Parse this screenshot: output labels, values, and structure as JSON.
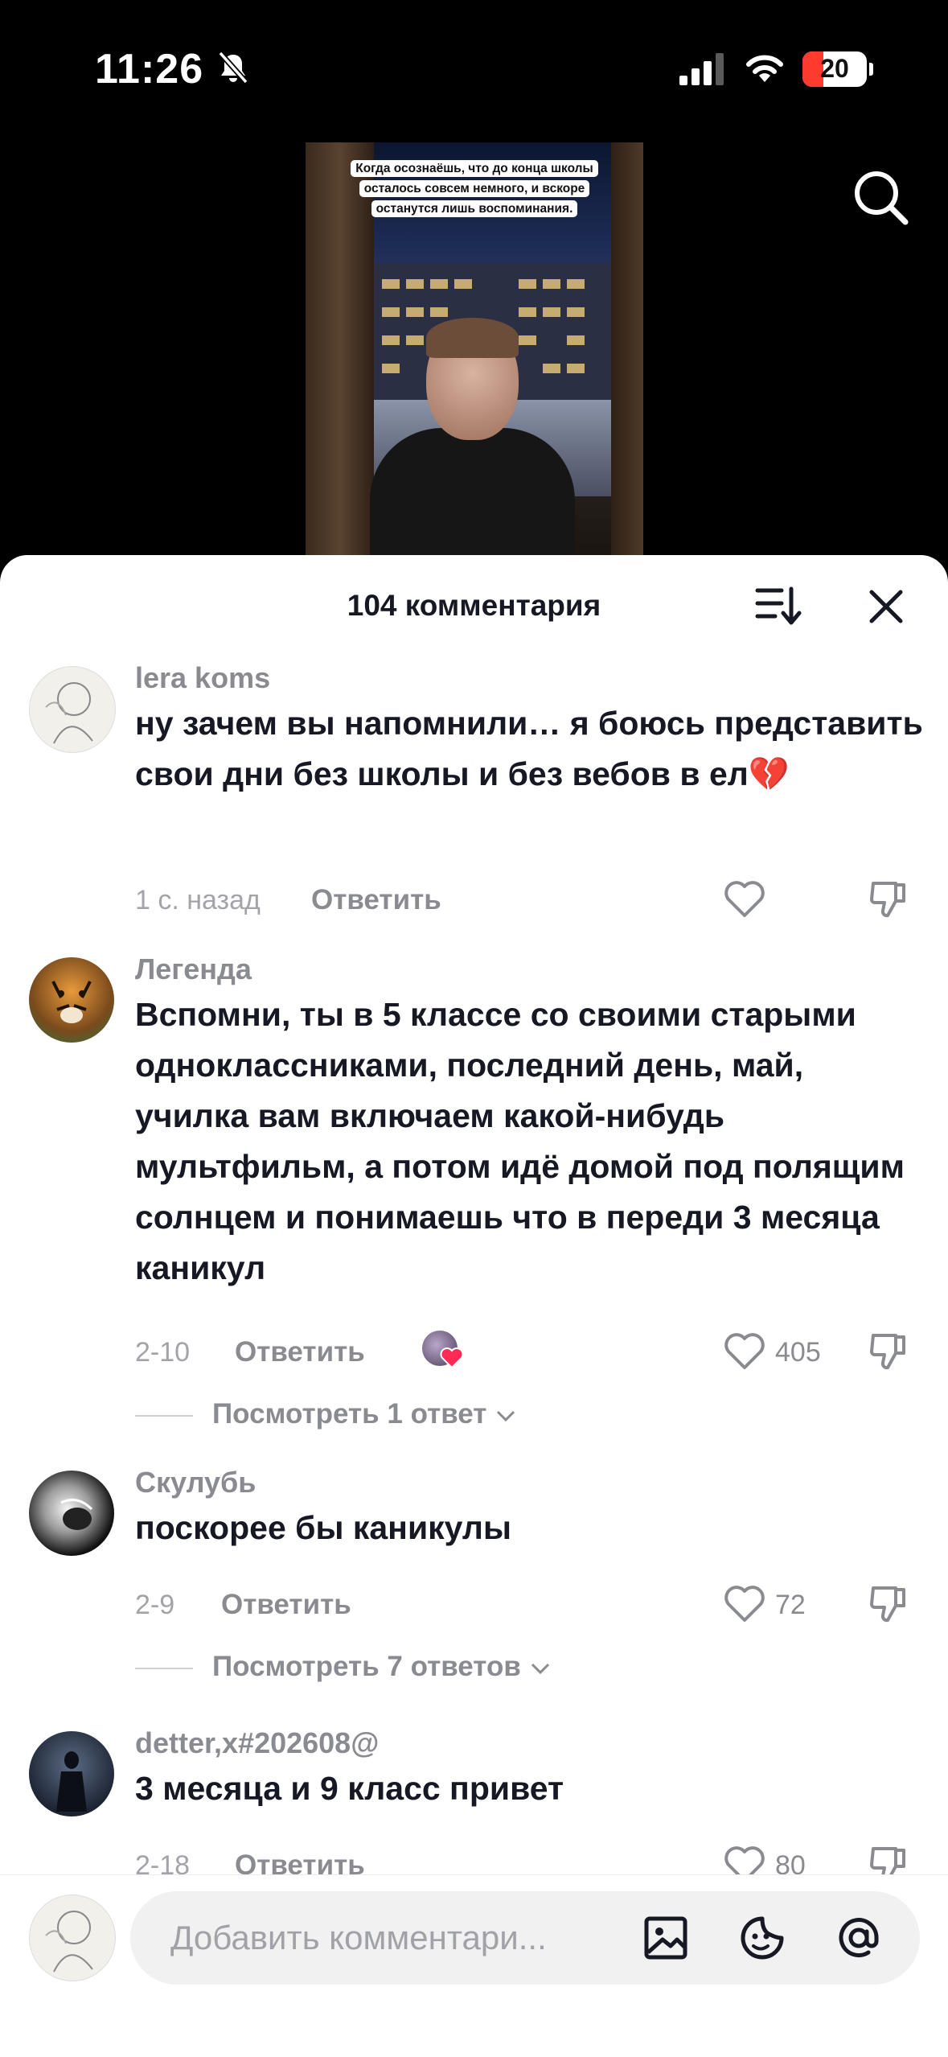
{
  "status_bar": {
    "time": "11:26",
    "battery": "20"
  },
  "video": {
    "caption": "Когда осознаёшь, что до конца школы осталось совсем немного, и вскоре останутся лишь воспоминания."
  },
  "comments_sheet": {
    "title": "104 комментария",
    "comments": [
      {
        "username": "lera koms",
        "text": "ну зачем вы напомнили… я боюсь представить свои дни без школы и без вебов в ел💔",
        "time": "1 с. назад",
        "reply_label": "Ответить",
        "likes": ""
      },
      {
        "username": "Легенда",
        "text": "Вспомни, ты в 5 классе со своими старыми одноклассниками, последний день, май, училка вам включаем какой-нибудь мультфильм, а потом идё домой под полящим солнцем и понимаешь что в переди 3 месяца каникул",
        "time": "2-10",
        "reply_label": "Ответить",
        "likes": "405",
        "view_replies": "Посмотреть 1 ответ"
      },
      {
        "username": "Скулубь",
        "text": "поскорее бы каникулы",
        "time": "2-9",
        "reply_label": "Ответить",
        "likes": "72",
        "view_replies": "Посмотреть 7 ответов"
      },
      {
        "username": "detter,x#202608@",
        "text": "3 месяца и 9 класс привет",
        "time": "2-18",
        "reply_label": "Ответить",
        "likes": "80"
      }
    ]
  },
  "input": {
    "placeholder": "Добавить комментари..."
  },
  "icons": [
    "bell-slash-icon",
    "signal-icon",
    "wifi-icon",
    "search-icon",
    "sort-icon",
    "close-icon",
    "heart-icon",
    "dislike-icon",
    "chevron-down-icon",
    "image-icon",
    "sticker-icon",
    "mention-icon"
  ],
  "colors": {
    "text": "#161823",
    "muted": "#8a8b91",
    "heart_red": "#fe2c55"
  }
}
